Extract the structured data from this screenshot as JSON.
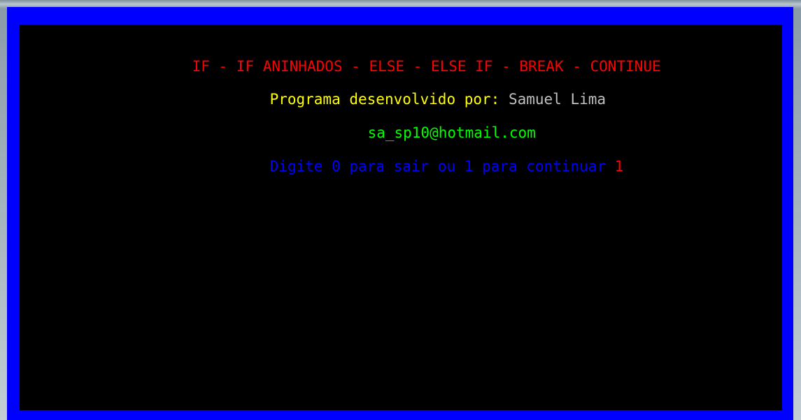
{
  "console": {
    "title_line": "IF - IF ANINHADOS - ELSE - ELSE IF - BREAK - CONTINUE",
    "credit_label": "Programa desenvolvido por:",
    "credit_name": " Samuel Lima",
    "email": "sa_sp10@hotmail.com",
    "prompt": "Digite 0 para sair ou 1 para continuar ",
    "input_value": "1"
  },
  "colors": {
    "border": "#0000ff",
    "background": "#000000",
    "title": "#ff0000",
    "credit_label": "#ffff00",
    "credit_name": "#c0c0c0",
    "email": "#00ff00",
    "prompt": "#0000ff",
    "input": "#ff0000"
  }
}
